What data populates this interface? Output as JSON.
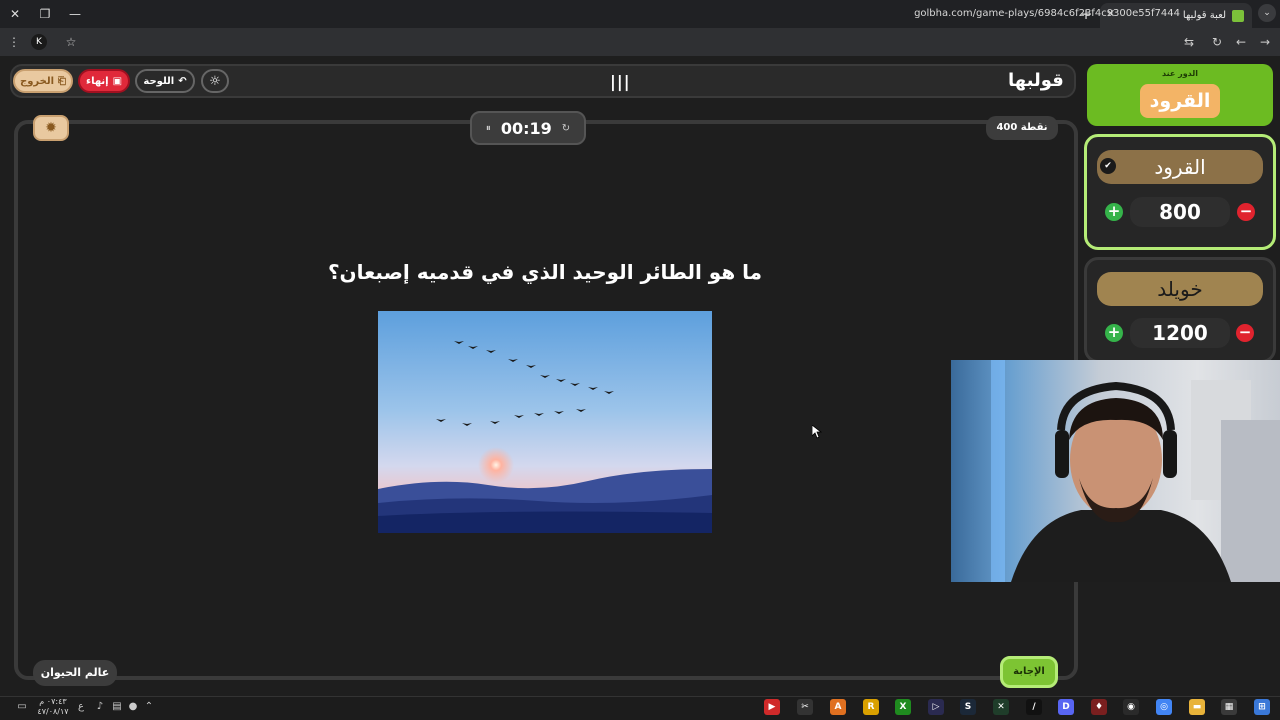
{
  "browser": {
    "tab_title": "لعبة قولبها",
    "url": "golbha.com/game-plays/6984c6f23f4c9300e55f7444",
    "profile_initial": "K"
  },
  "nav": {
    "logo": "قولبها",
    "exit_label": "الخروج",
    "end_label": "إنهاء",
    "board_label": "اللوحة"
  },
  "question": {
    "points": "400 نقطة",
    "timer": "00:19",
    "text": "ما هو الطائر الوحيد الذي في قدميه إصبعان؟",
    "category": "عالم الحيوان",
    "answer_label": "الإجابة"
  },
  "turn": {
    "label": "الدور عند",
    "team": "القرود"
  },
  "teams": [
    {
      "name": "القرود",
      "score": "800"
    },
    {
      "name": "خويلد",
      "score": "1200"
    }
  ],
  "taskbar": {
    "time": "٠٧:٤٣ م",
    "date": "٤٧/٠٨/١٧",
    "lang": "ع"
  }
}
